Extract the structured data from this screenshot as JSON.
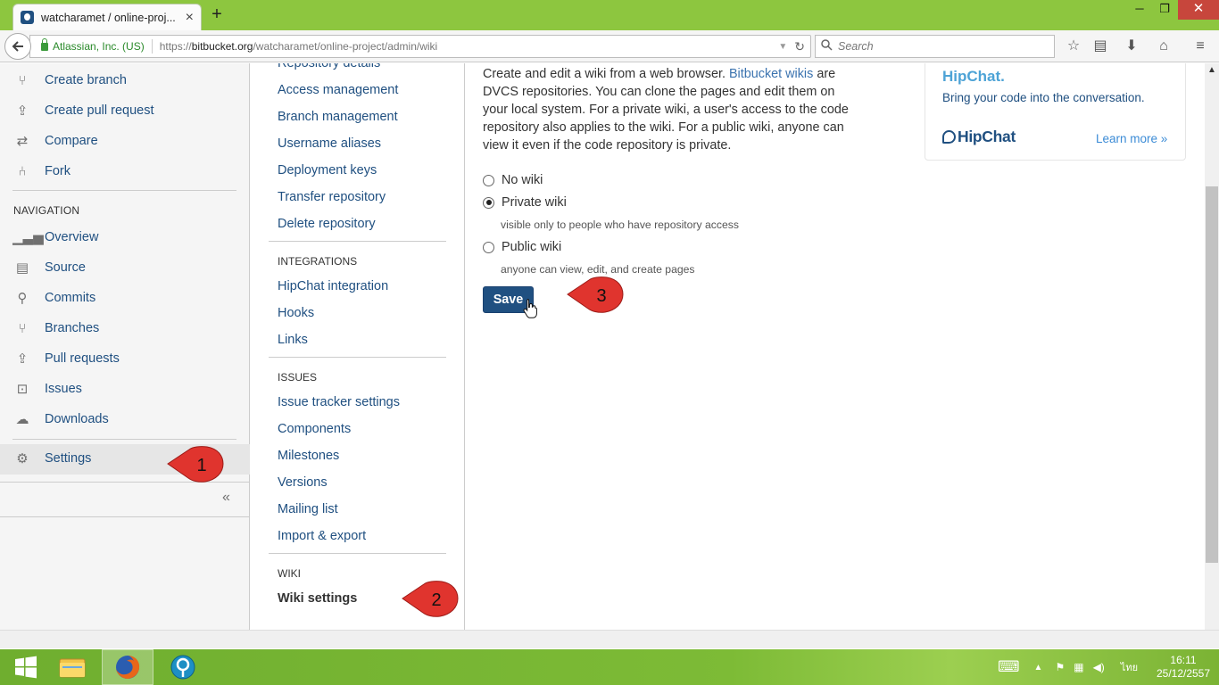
{
  "browser": {
    "tab_title": "watcharamet / online-proj...",
    "tab_close": "×",
    "new_tab": "+",
    "win_min": "─",
    "win_max": "❐",
    "win_close": "✕",
    "site_identity": "Atlassian, Inc. (US)",
    "url_prefix": "https://",
    "url_domain": "bitbucket.org",
    "url_path": "/watcharamet/online-project/admin/wiki",
    "search_placeholder": "Search"
  },
  "left_nav": {
    "actions": [
      {
        "label": "Create branch",
        "icon": "branch-icon"
      },
      {
        "label": "Create pull request",
        "icon": "pull-request-icon"
      },
      {
        "label": "Compare",
        "icon": "compare-icon"
      },
      {
        "label": "Fork",
        "icon": "fork-icon"
      }
    ],
    "navigation_heading": "NAVIGATION",
    "navigation": [
      {
        "label": "Overview"
      },
      {
        "label": "Source"
      },
      {
        "label": "Commits"
      },
      {
        "label": "Branches"
      },
      {
        "label": "Pull requests"
      },
      {
        "label": "Issues"
      },
      {
        "label": "Downloads"
      }
    ],
    "settings_label": "Settings",
    "collapse": "«"
  },
  "settings_nav": {
    "general": [
      "Repository details",
      "Access management",
      "Branch management",
      "Username aliases",
      "Deployment keys",
      "Transfer repository",
      "Delete repository"
    ],
    "integrations_heading": "INTEGRATIONS",
    "integrations": [
      "HipChat integration",
      "Hooks",
      "Links"
    ],
    "issues_heading": "ISSUES",
    "issues": [
      "Issue tracker settings",
      "Components",
      "Milestones",
      "Versions",
      "Mailing list",
      "Import & export"
    ],
    "wiki_heading": "WIKI",
    "wiki_settings": "Wiki settings"
  },
  "main": {
    "desc_before": "Create and edit a wiki from a web browser. ",
    "desc_link": "Bitbucket wikis",
    "desc_after": " are DVCS repositories. You can clone the pages and edit them on your local system. For a private wiki, a user's access to the code repository also applies to the wiki. For a public wiki, anyone can view it even if the code repository is private.",
    "options": [
      {
        "label": "No wiki",
        "desc": "",
        "selected": false
      },
      {
        "label": "Private wiki",
        "desc": "visible only to people who have repository access",
        "selected": true
      },
      {
        "label": "Public wiki",
        "desc": "anyone can view, edit, and create pages",
        "selected": false
      }
    ],
    "save_label": "Save"
  },
  "promo": {
    "title": "HipChat.",
    "desc": "Bring your code into the conversation.",
    "logo": "HipChat",
    "learn_more": "Learn more »"
  },
  "annotations": [
    "1",
    "2",
    "3"
  ],
  "taskbar": {
    "lang": "ไทย",
    "time": "16:11",
    "date": "25/12/2557"
  },
  "colors": {
    "titlebar": "#8dc63f",
    "link": "#205081",
    "save_button": "#205081",
    "annotation_red": "#e0342e"
  }
}
